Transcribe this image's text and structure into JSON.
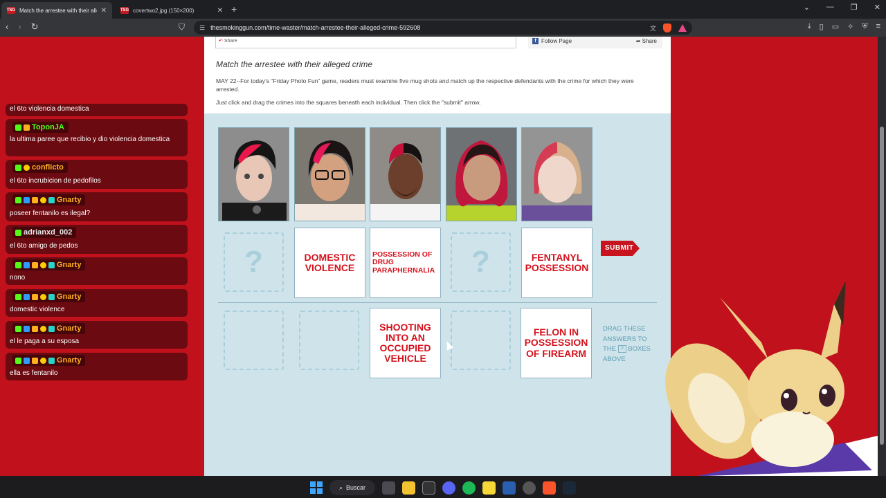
{
  "browser": {
    "tabs": [
      {
        "title": "Match the arrestee with their alle",
        "favicon": "tsg"
      },
      {
        "title": "covertwo2.jpg (150×200)",
        "favicon": "tsg"
      }
    ],
    "url": "thesmokinggun.com/time-waster/match-arrestee-their-alleged-crime-592608"
  },
  "chat": {
    "messages": [
      {
        "user": "",
        "text": "el 6to violencia domestica"
      },
      {
        "user": "ToponJA",
        "color": "#53fc18",
        "text": "la ultima paree que recibio y dio violencia domestica"
      },
      {
        "user": "conflicto",
        "color": "#ffb020",
        "text": "el 6to incrubicion de pedofilos"
      },
      {
        "user": "Gnarty",
        "color": "#ffb020",
        "text": "poseer fentanilo es ilegal?"
      },
      {
        "user": "adrianxd_002",
        "color": "#e8e8e8",
        "text": "el 6to amigo de pedos"
      },
      {
        "user": "Gnarty",
        "color": "#ffb020",
        "text": "nono"
      },
      {
        "user": "Gnarty",
        "color": "#ffb020",
        "text": "domestic violence"
      },
      {
        "user": "Gnarty",
        "color": "#ffb020",
        "text": "el le paga a su esposa"
      },
      {
        "user": "Gnarty",
        "color": "#ffb020",
        "text": "ella es fentanilo"
      }
    ]
  },
  "article": {
    "share_label": "Share",
    "follow_label": "Follow Page",
    "follow_share_label": "Share",
    "headline": "Match the arrestee with their alleged crime",
    "intro": "MAY 22--For today’s “Friday Photo Fun” game, readers must examine five mug shots and match up the respective defendants with the crime for which they were arrested.",
    "instructions": "Just click and drag the crimes into the squares beneath each individual. Then click the \"submit\" arrow."
  },
  "game": {
    "slots": [
      {
        "placed": "",
        "qmark": "?"
      },
      {
        "placed": "DOMESTIC VIOLENCE"
      },
      {
        "placed": "POSSESSION OF DRUG PARAPHERNALIA"
      },
      {
        "placed": "",
        "qmark": "?"
      },
      {
        "placed": "FENTANYL POSSESSION"
      }
    ],
    "answers": [
      {
        "text": ""
      },
      {
        "text": ""
      },
      {
        "text": "SHOOTING INTO AN OCCUPIED VEHICLE"
      },
      {
        "text": ""
      },
      {
        "text": "FELON IN POSSESSION OF FIREARM"
      }
    ],
    "submit_label": "SUBMIT",
    "hint_before": "DRAG THESE ANSWERS TO THE",
    "hint_icon": "?",
    "hint_after": "BOXES ABOVE"
  },
  "taskbar": {
    "search_label": "Buscar"
  },
  "colors": {
    "brand_red": "#c0111c",
    "game_bg": "#cfe3ea",
    "card_text": "#d4111c"
  }
}
